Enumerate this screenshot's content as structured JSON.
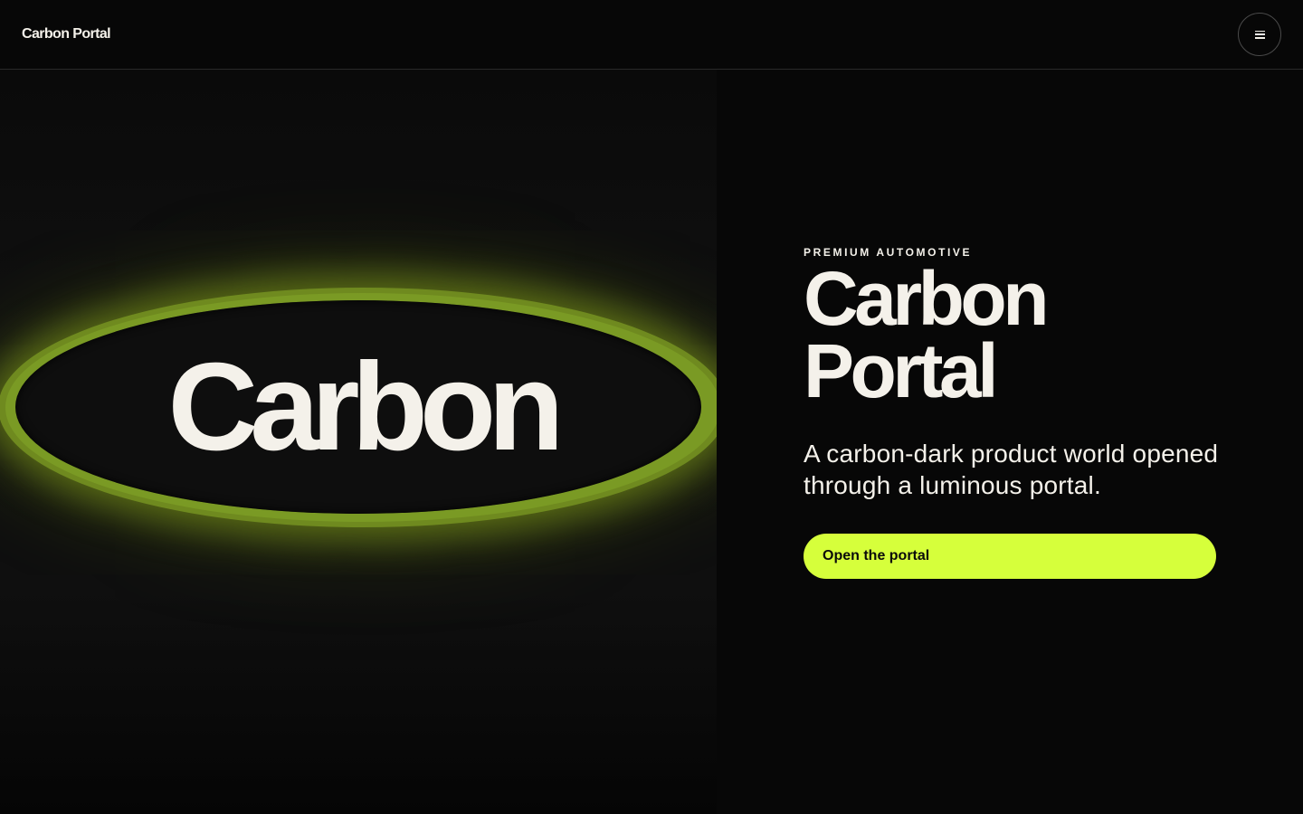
{
  "header": {
    "brand": "Carbon Portal",
    "menu_icon": "hamburger-menu-icon"
  },
  "stage": {
    "portal_word": "Carbon",
    "accent_color": "#d6ff3b"
  },
  "hero": {
    "eyebrow": "PREMIUM AUTOMOTIVE",
    "headline_line1": "Carbon",
    "headline_line2": "Portal",
    "subhead": "A carbon-dark product world opened through a luminous portal.",
    "cta_label": "Open the portal"
  },
  "colors": {
    "background": "#070707",
    "text": "#f4f1ea",
    "cta": "#d6ff3b",
    "portal_ring": "#7a9a24"
  }
}
